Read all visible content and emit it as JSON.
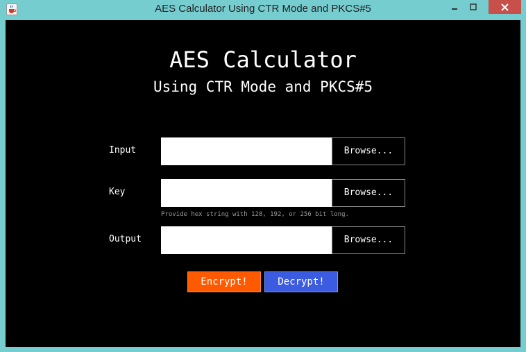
{
  "window": {
    "title": "AES Calculator Using CTR Mode and PKCS#5",
    "icon": "java-cup-icon",
    "controls": {
      "minimize": "—",
      "maximize": "□",
      "close": "✕"
    }
  },
  "header": {
    "title": "AES Calculator",
    "subtitle": "Using CTR Mode and PKCS#5"
  },
  "form": {
    "input": {
      "label": "Input",
      "value": "",
      "browse_label": "Browse..."
    },
    "key": {
      "label": "Key",
      "value": "",
      "browse_label": "Browse...",
      "hint": "Provide hex string with 128, 192, or 256 bit long."
    },
    "output": {
      "label": "Output",
      "value": "",
      "browse_label": "Browse..."
    }
  },
  "actions": {
    "encrypt_label": "Encrypt!",
    "decrypt_label": "Decrypt!"
  },
  "colors": {
    "frame": "#75cdd0",
    "background": "#000000",
    "encrypt": "#ff5a00",
    "decrypt": "#3b5be0",
    "close": "#c7504a"
  }
}
